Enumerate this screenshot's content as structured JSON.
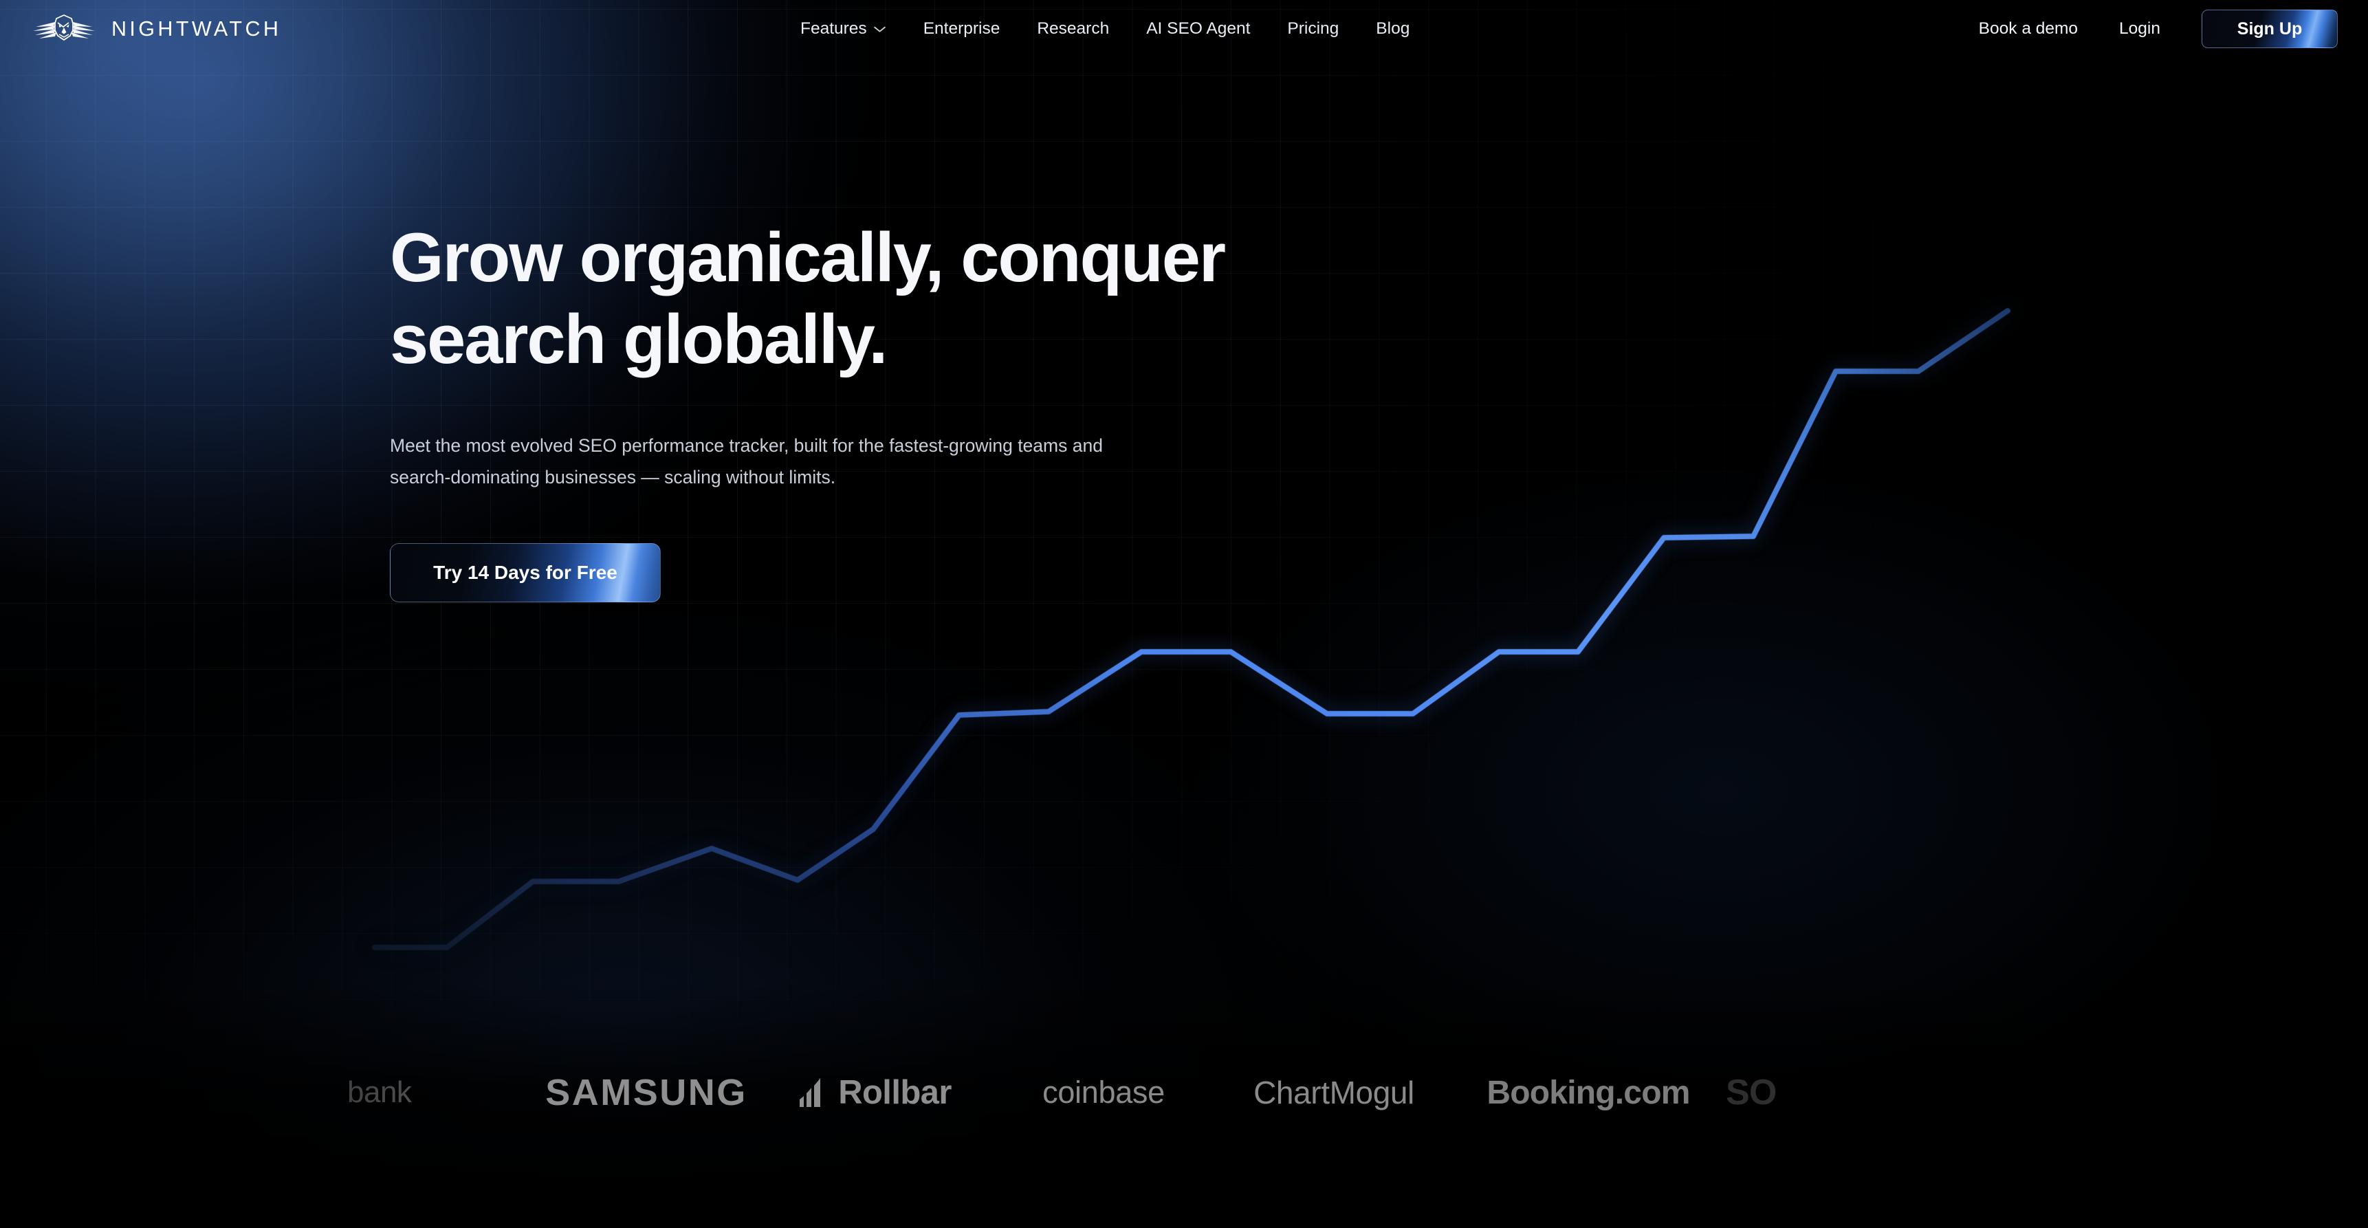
{
  "brand": {
    "name": "NIGHTWATCH",
    "logo_icon": "owl-wings-icon"
  },
  "nav": {
    "items": [
      {
        "label": "Features",
        "has_dropdown": true,
        "icon": "chevron-down-icon"
      },
      {
        "label": "Enterprise",
        "has_dropdown": false
      },
      {
        "label": "Research",
        "has_dropdown": false
      },
      {
        "label": "AI SEO Agent",
        "has_dropdown": false
      },
      {
        "label": "Pricing",
        "has_dropdown": false
      },
      {
        "label": "Blog",
        "has_dropdown": false
      }
    ],
    "book_demo": "Book a demo",
    "login": "Login",
    "signup": "Sign Up"
  },
  "hero": {
    "headline_line1": "Grow organically, conquer",
    "headline_line2": "search globally.",
    "subheadline": "Meet the most evolved SEO performance tracker, built for the fastest-growing teams and search-dominating businesses — scaling without limits.",
    "cta_label": "Try 14 Days for Free"
  },
  "clients": {
    "logos": [
      {
        "name": "bank",
        "label": "bank"
      },
      {
        "name": "samsung",
        "label": "SAMSUNG"
      },
      {
        "name": "rollbar",
        "label": "Rollbar",
        "icon": "rollbar-bars-icon"
      },
      {
        "name": "coinbase",
        "label": "coinbase"
      },
      {
        "name": "chartmogul",
        "label": "ChartMogul"
      },
      {
        "name": "booking",
        "label": "Booking.com"
      },
      {
        "name": "soundcloud",
        "label": "SO"
      }
    ]
  },
  "colors": {
    "accent_blue": "#4a86f0",
    "brand_glow": "#2d4a7a",
    "background": "#000000",
    "text_primary": "#f5f7fa",
    "text_secondary": "#c8cfdb"
  },
  "chart_data": {
    "type": "line",
    "title": "",
    "xlabel": "",
    "ylabel": "",
    "grid": true,
    "legend": null,
    "line_color": "#4a86f0",
    "line_gradient": [
      "#13203a",
      "#2b55a8",
      "#5a93f5",
      "#3f6fc4"
    ],
    "x": [
      545,
      650,
      775,
      900,
      1035,
      1160,
      1270,
      1395,
      1525,
      1660,
      1790,
      1930,
      2055,
      2180,
      2295,
      2420,
      2550,
      2670,
      2790,
      2920
    ],
    "y": [
      1378,
      1378,
      1282,
      1282,
      1234,
      1280,
      1206,
      1040,
      1035,
      948,
      948,
      1038,
      1038,
      948,
      948,
      782,
      780,
      540,
      540,
      452
    ],
    "xlim": [
      500,
      3000
    ],
    "ylim": [
      1540,
      420
    ]
  }
}
